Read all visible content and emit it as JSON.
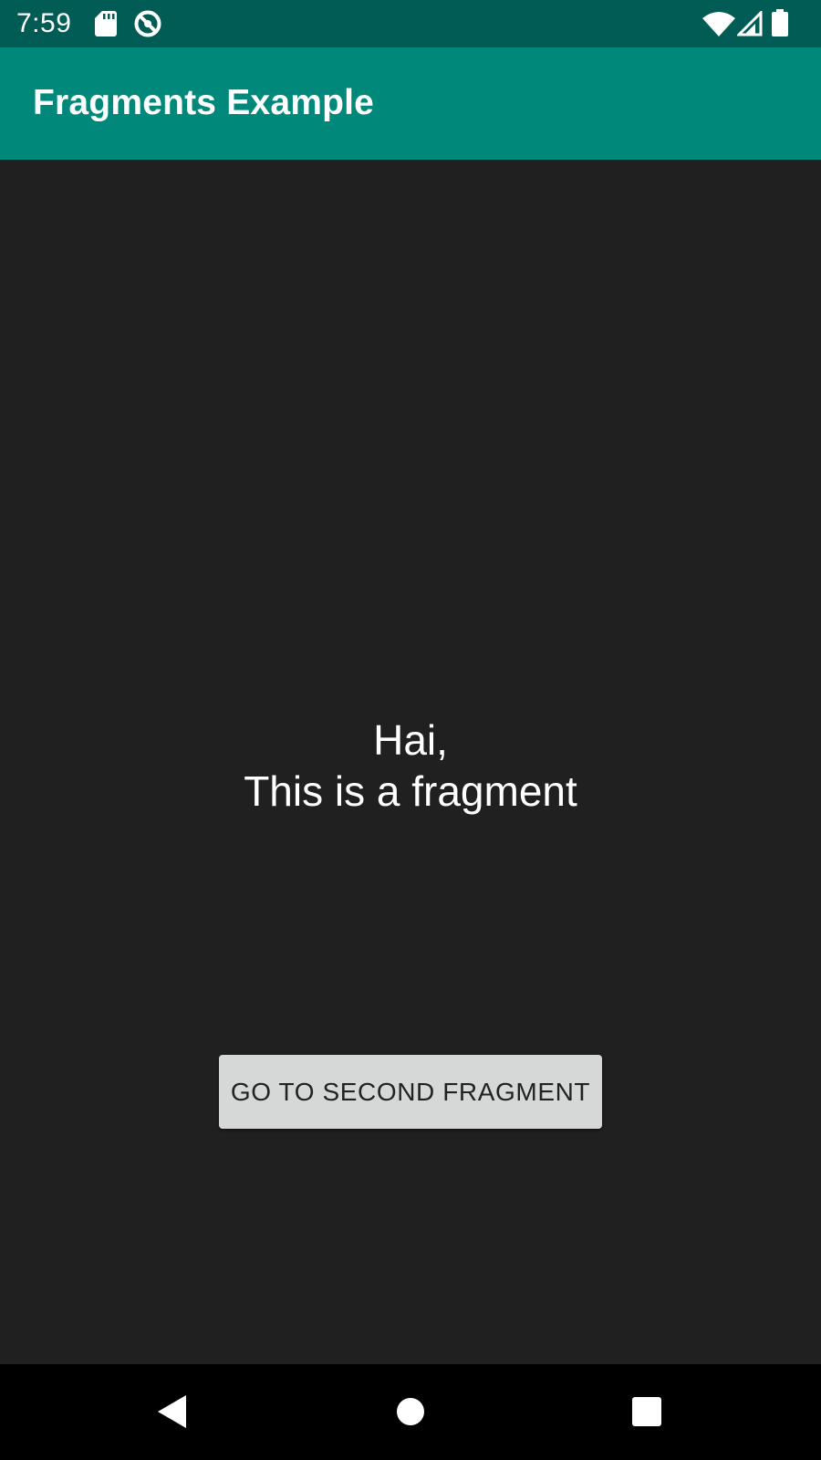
{
  "status_bar": {
    "time": "7:59",
    "icons": [
      "sd-card-icon",
      "vpn-icon",
      "wifi-icon",
      "signal-icon",
      "battery-icon"
    ]
  },
  "app_bar": {
    "title": "Fragments Example",
    "color": "#00897b",
    "status_color": "#005c54"
  },
  "fragment": {
    "line1": "Hai,",
    "line2": "This is a fragment",
    "background": "#202020"
  },
  "button": {
    "label": "GO TO SECOND FRAGMENT",
    "background": "#d6d7d7"
  },
  "nav_bar": {
    "buttons": [
      "back-icon",
      "home-icon",
      "recents-icon"
    ]
  }
}
